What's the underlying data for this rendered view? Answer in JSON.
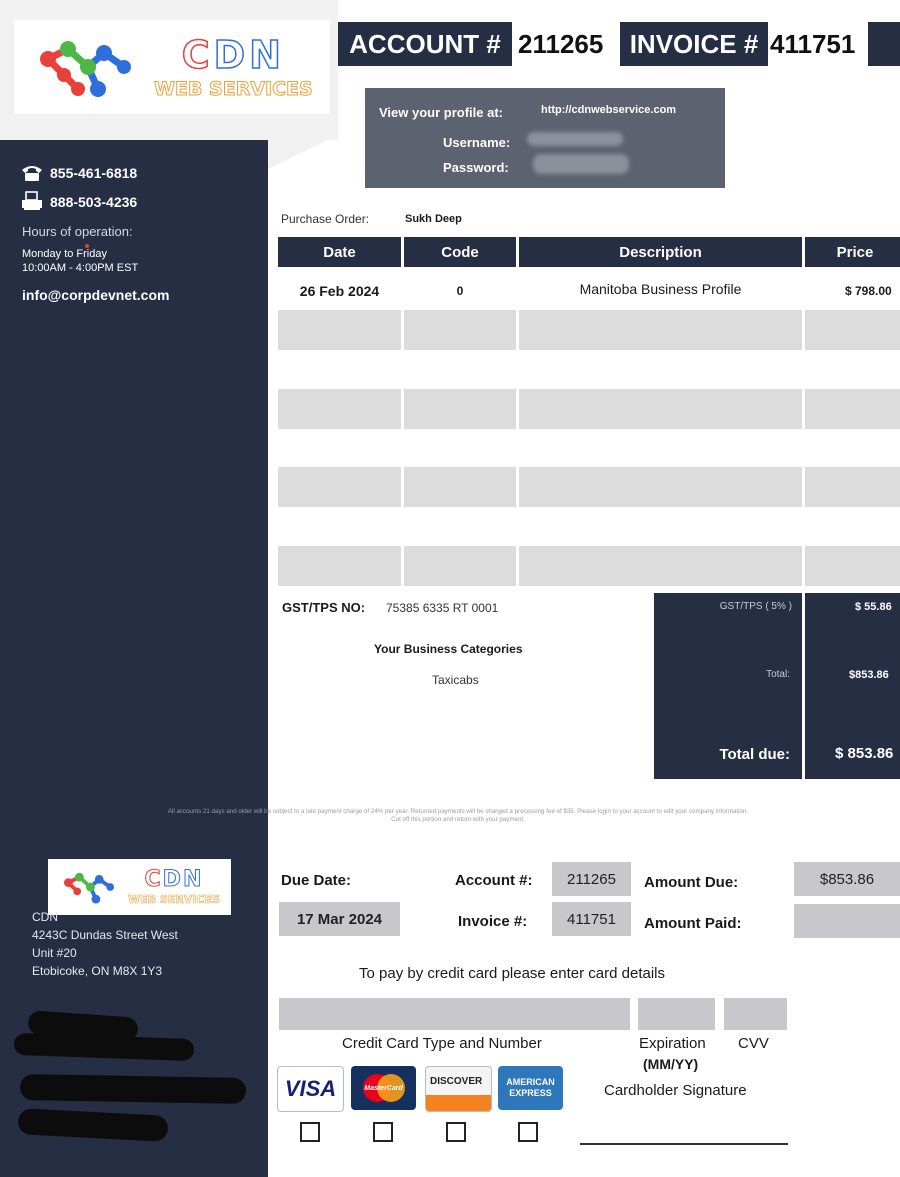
{
  "brand": {
    "logo_letters": [
      "C",
      "D",
      "N"
    ],
    "logo_tagline": "WEB SERVICES",
    "colors": {
      "navy": "#262e44",
      "red": "#e8413c",
      "blue": "#2f6fdc",
      "green": "#4db848"
    }
  },
  "header": {
    "account_label": "ACCOUNT #",
    "account_number": "211265",
    "invoice_label": "INVOICE #",
    "invoice_number": "411751"
  },
  "profile": {
    "view_label": "View your profile at:",
    "url": "http://cdnwebservice.com",
    "username_label": "Username:",
    "password_label": "Password:"
  },
  "contact": {
    "phone": "855-461-6818",
    "fax": "888-503-4236",
    "hours_label": "Hours of operation:",
    "hours_days": "Monday to Friday",
    "hours_time": "10:00AM - 4:00PM EST",
    "email": "info@corpdevnet.com"
  },
  "purchase_order": {
    "label": "Purchase Order:",
    "value": "Sukh Deep"
  },
  "table": {
    "headers": [
      "Date",
      "Code",
      "Description",
      "Price"
    ],
    "rows": [
      {
        "date": "26 Feb 2024",
        "code": "0",
        "description": "Manitoba Business Profile",
        "price": "$ 798.00"
      }
    ]
  },
  "gst": {
    "label": "GST/TPS NO:",
    "value": "75385 6335 RT 0001"
  },
  "categories": {
    "title": "Your Business Categories",
    "value": "Taxicabs"
  },
  "totals": {
    "gst_label": "GST/TPS ( 5% )",
    "gst_value": "$ 55.86",
    "total_label": "Total:",
    "total_value": "$853.86",
    "due_label": "Total due:",
    "due_value": "$ 853.86"
  },
  "notice": {
    "line1": "All accounts 21 days and older will be subject to a late payment charge of 24% per year. Returned payments will be charged a processing fee of $35. Please login to your account to edit your company information.",
    "line2": "Cut off this portion and return with your payment."
  },
  "remit": {
    "due_date_label": "Due Date:",
    "due_date": "17 Mar 2024",
    "account_label": "Account #:",
    "account_value": "211265",
    "invoice_label": "Invoice #:",
    "invoice_value": "411751",
    "amount_due_label": "Amount Due:",
    "amount_due": "$853.86",
    "amount_paid_label": "Amount Paid:",
    "amount_paid": ""
  },
  "address": {
    "name": "CDN",
    "street": "4243C Dundas Street West",
    "unit": "Unit #20",
    "city": "Etobicoke, ON M8X 1Y3"
  },
  "payment": {
    "instruction": "To pay by credit card please enter card details",
    "card_label": "Credit Card Type and Number",
    "expiration_label": "Expiration",
    "expiration_format": "(MM/YY)",
    "cvv_label": "CVV",
    "signature_label": "Cardholder Signature",
    "cards": [
      "VISA",
      "MasterCard",
      "DISCOVER",
      "AMERICAN EXPRESS"
    ]
  }
}
